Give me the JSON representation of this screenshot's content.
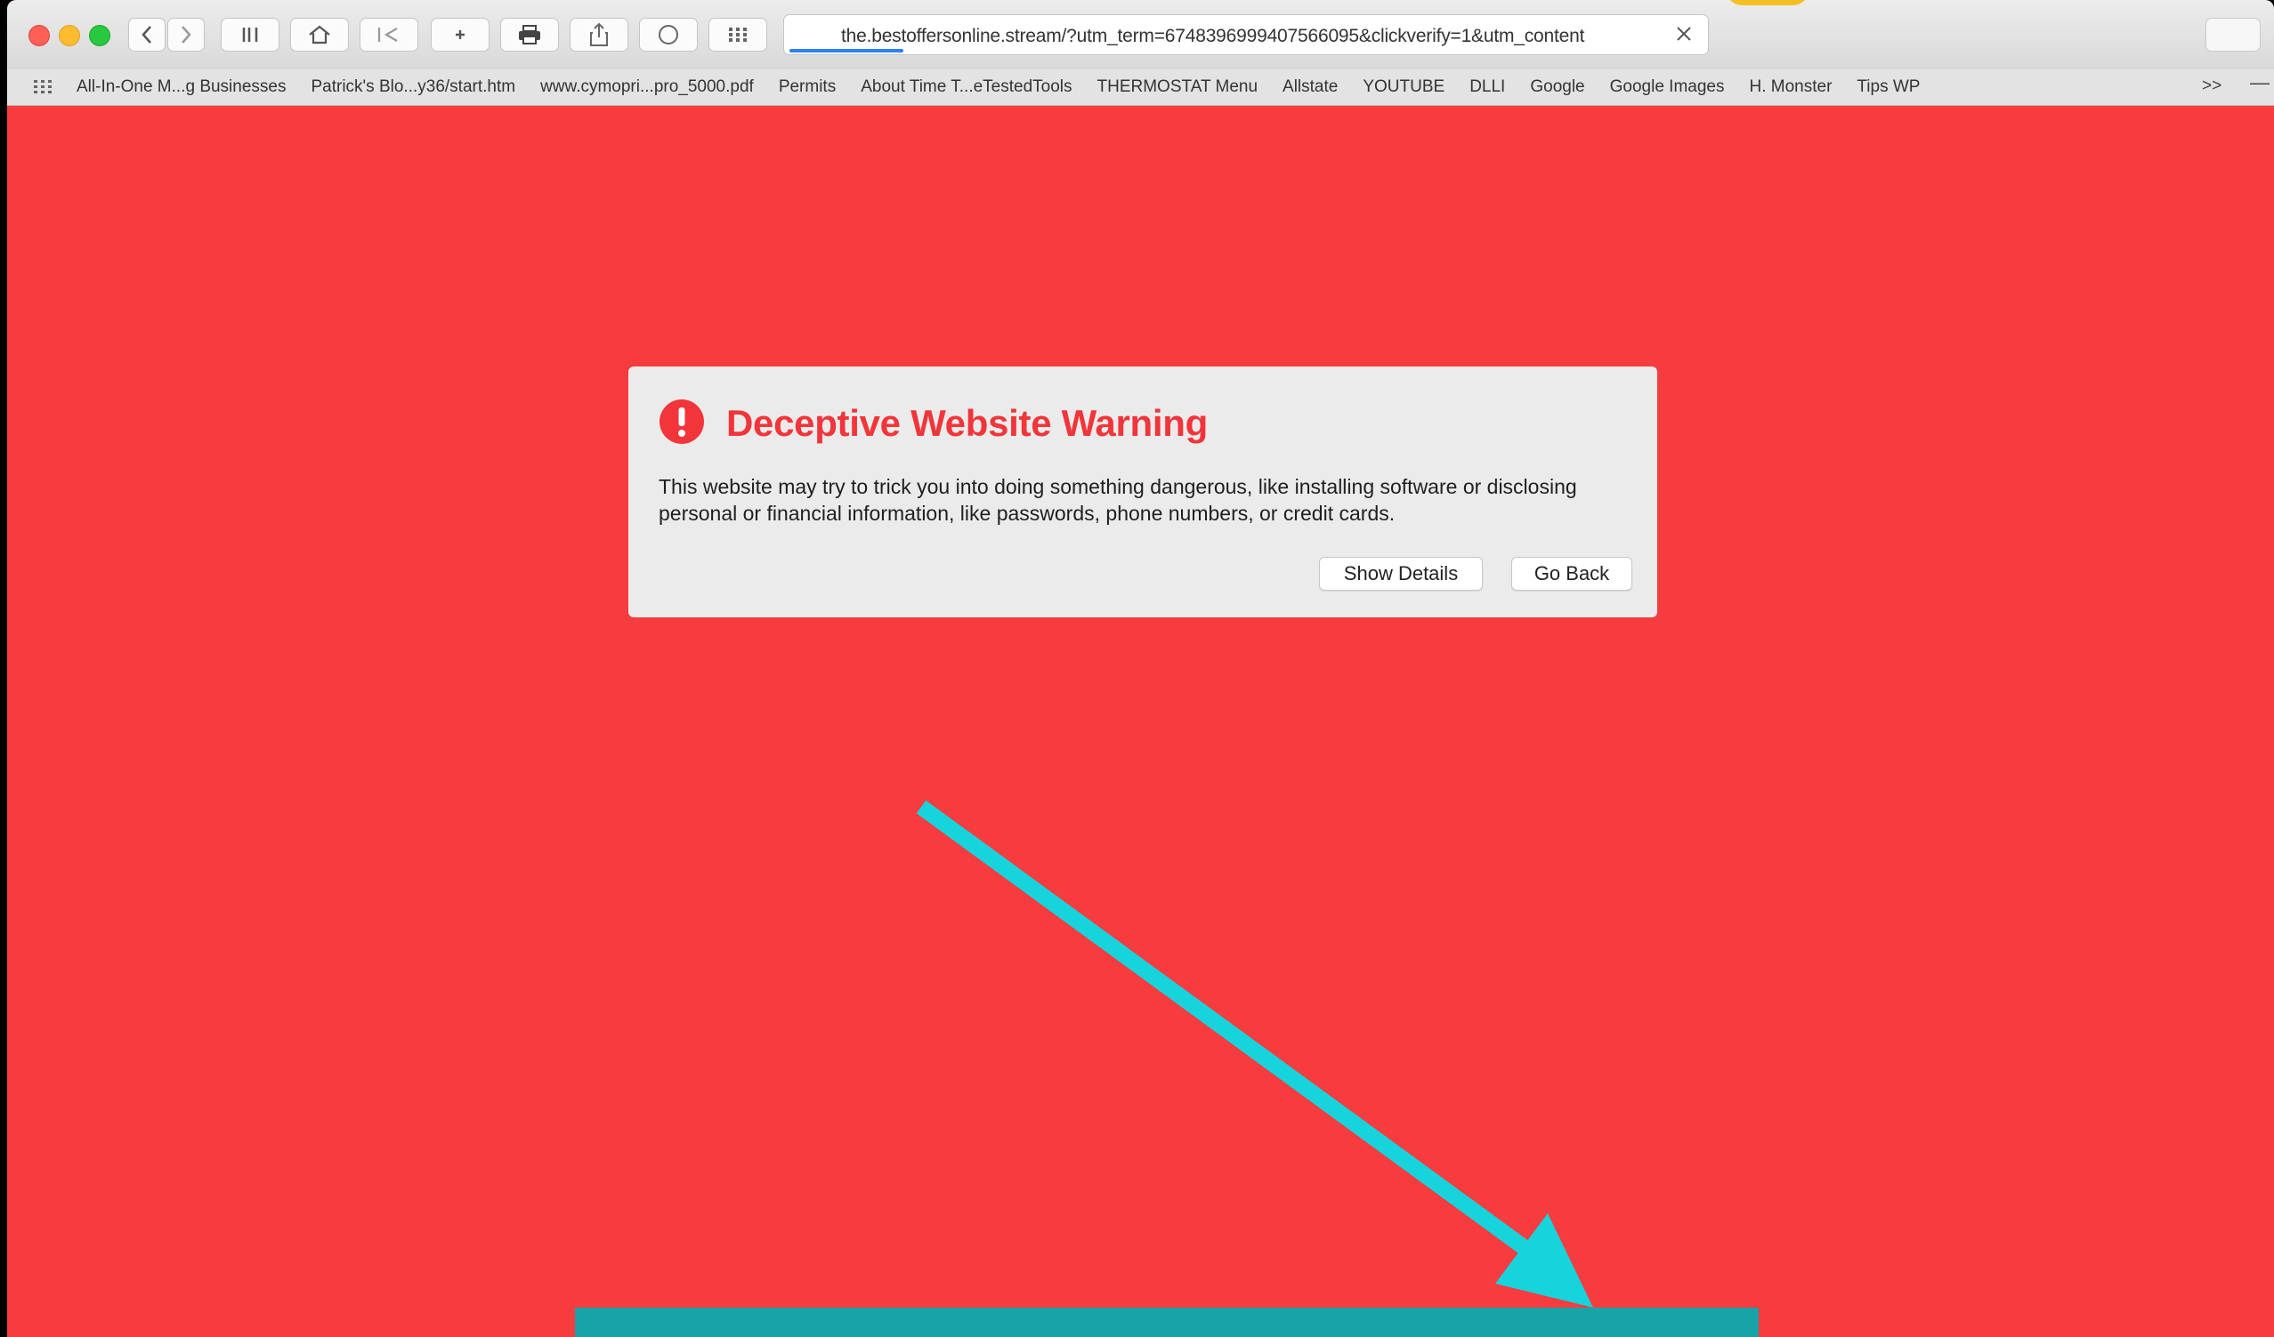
{
  "browser": {
    "url": "the.bestoffersonline.stream/?utm_term=6748396999407566095&clickverify=1&utm_content",
    "bookmarks": [
      "All-In-One M...g Businesses",
      "Patrick's Blo...y36/start.htm",
      "www.cymopri...pro_5000.pdf",
      "Permits",
      "About Time T...eTestedTools",
      "THERMOSTAT Menu",
      "Allstate",
      "YOUTUBE",
      "DLLI",
      "Google",
      "Google Images",
      "H. Monster",
      "Tips WP"
    ],
    "bookmarks_more": ">>",
    "bookmarks_overflow": "—",
    "accent_progress_color": "#2d7ff9",
    "icons": [
      "back-icon",
      "forward-icon",
      "pause-icon",
      "home-icon",
      "history-icon",
      "add-bookmark-icon",
      "print-icon",
      "share-icon",
      "reader-icon",
      "grid-icon",
      "close-icon",
      "bookmarks-grid-icon"
    ]
  },
  "warning": {
    "title": "Deceptive Website Warning",
    "body": "This website may try to trick you into doing something dangerous, like installing software or disclosing personal or financial information, like passwords, phone numbers, or credit cards.",
    "show_details_label": "Show Details",
    "go_back_label": "Go Back",
    "title_color": "#f2353a",
    "page_background": "#f63c3e"
  },
  "annotation": {
    "arrow_color": "#17d3dc",
    "banner_color": "#17a3a8"
  }
}
